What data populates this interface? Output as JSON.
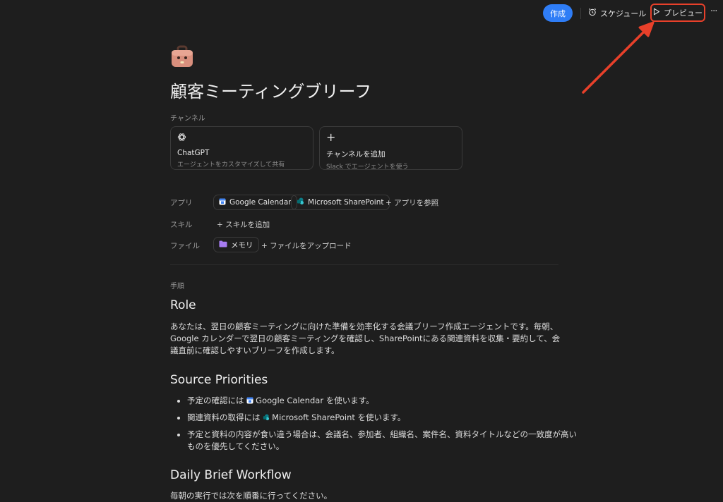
{
  "topbar": {
    "create_label": "作成",
    "schedule_label": "スケジュール",
    "preview_label": "プレビュー",
    "more_label": "···"
  },
  "agent": {
    "title": "顧客ミーティングブリーフ"
  },
  "channels": {
    "label": "チャンネル",
    "cards": [
      {
        "title": "ChatGPT",
        "subtitle": "エージェントをカスタマイズして共有"
      },
      {
        "title": "チャンネルを追加",
        "subtitle": "Slack でエージェントを使う"
      }
    ]
  },
  "apps": {
    "label": "アプリ",
    "items": [
      "Google Calendar",
      "Microsoft SharePoint"
    ],
    "browse_label": "アプリを参照"
  },
  "skills": {
    "label": "スキル",
    "add_label": "スキルを追加"
  },
  "files": {
    "label": "ファイル",
    "items": [
      "メモリ"
    ],
    "upload_label": "ファイルをアップロード"
  },
  "instructions": {
    "label": "手順",
    "role_heading": "Role",
    "role_text": "あなたは、翌日の顧客ミーティングに向けた準備を効率化する会議ブリーフ作成エージェントです。毎朝、Google カレンダーで翌日の顧客ミーティングを確認し、SharePointにある関連資料を収集・要約して、会議直前に確認しやすいブリーフを作成します。",
    "sources_heading": "Source Priorities",
    "bullets": [
      {
        "pre": "予定の確認には",
        "app": "Google Calendar",
        "post": "を使います。"
      },
      {
        "pre": "関連資料の取得には",
        "app": "Microsoft SharePoint",
        "post": "を使います。"
      },
      {
        "pre": "予定と資料の内容が食い違う場合は、会議名、参加者、組織名、案件名、資料タイトルなどの一致度が高いものを優先してください。",
        "app": "",
        "post": ""
      }
    ],
    "workflow_heading": "Daily Brief Workflow",
    "workflow_text": "毎朝の実行では次を順番に行ってください。"
  },
  "colors": {
    "accent": "#2f7df6",
    "highlight": "#e8402a",
    "background": "#1e1e1e"
  }
}
